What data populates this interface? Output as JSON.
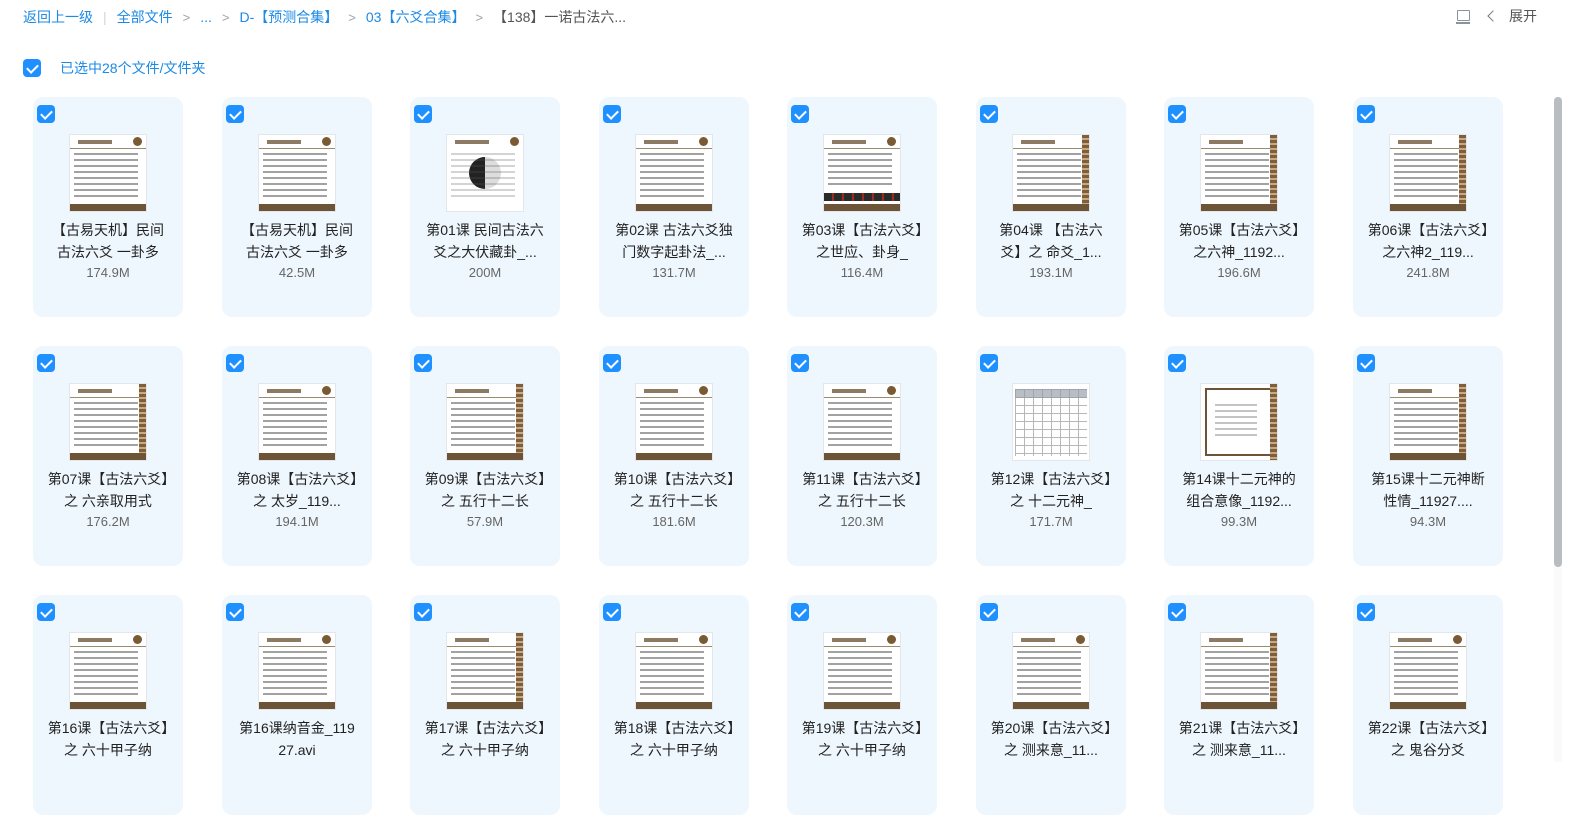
{
  "breadcrumb": {
    "back": "返回上一级",
    "all_files": "全部文件",
    "ellipsis": "...",
    "folder1": "D-【预测合集】",
    "folder2": "03【六爻合集】",
    "current": "【138】一诺古法六..."
  },
  "toolbar": {
    "expand_label": "展开"
  },
  "selection": {
    "label": "已选中28个文件/文件夹"
  },
  "files": [
    {
      "name": "【古易天机】民间古法六爻 一卦多",
      "size": "174.9M",
      "thumb": "lines"
    },
    {
      "name": "【古易天机】民间古法六爻 一卦多",
      "size": "42.5M",
      "thumb": "lines"
    },
    {
      "name": "第01课 民间古法六爻之大伏藏卦_...",
      "size": "200M",
      "thumb": "taiji"
    },
    {
      "name": "第02课 古法六爻独门数字起卦法_...",
      "size": "131.7M",
      "thumb": "lines"
    },
    {
      "name": "第03课【古法六爻】之世应、卦身_",
      "size": "116.4M",
      "thumb": "bars"
    },
    {
      "name": "第04课 【古法六爻】之 命爻_1...",
      "size": "193.1M",
      "thumb": "side"
    },
    {
      "name": "第05课【古法六爻】之六神_1192...",
      "size": "196.6M",
      "thumb": "side"
    },
    {
      "name": "第06课【古法六爻】之六神2_119...",
      "size": "241.8M",
      "thumb": "side"
    },
    {
      "name": "第07课【古法六爻】之 六亲取用式",
      "size": "176.2M",
      "thumb": "side"
    },
    {
      "name": "第08课【古法六爻】之 太岁_119...",
      "size": "194.1M",
      "thumb": "lines"
    },
    {
      "name": "第09课【古法六爻】之 五行十二长",
      "size": "57.9M",
      "thumb": "side"
    },
    {
      "name": "第10课【古法六爻】之 五行十二长",
      "size": "181.6M",
      "thumb": "lines"
    },
    {
      "name": "第11课【古法六爻】之 五行十二长",
      "size": "120.3M",
      "thumb": "lines"
    },
    {
      "name": "第12课【古法六爻】之 十二元神_",
      "size": "171.7M",
      "thumb": "table"
    },
    {
      "name": "第14课十二元神的组合意像_1192...",
      "size": "99.3M",
      "thumb": "frame"
    },
    {
      "name": "第15课十二元神断性情_11927....",
      "size": "94.3M",
      "thumb": "side"
    },
    {
      "name": "第16课【古法六爻】之 六十甲子纳",
      "size": "",
      "thumb": "lines"
    },
    {
      "name": "第16课纳音金_11927.avi",
      "size": "",
      "thumb": "lines"
    },
    {
      "name": "第17课【古法六爻】之 六十甲子纳",
      "size": "",
      "thumb": "side"
    },
    {
      "name": "第18课【古法六爻】之 六十甲子纳",
      "size": "",
      "thumb": "lines"
    },
    {
      "name": "第19课【古法六爻】之 六十甲子纳",
      "size": "",
      "thumb": "lines"
    },
    {
      "name": "第20课【古法六爻】之 测来意_11...",
      "size": "",
      "thumb": "lines"
    },
    {
      "name": "第21课【古法六爻】之 测来意_11...",
      "size": "",
      "thumb": "side"
    },
    {
      "name": "第22课【古法六爻】之 鬼谷分爻",
      "size": "",
      "thumb": "lines"
    }
  ]
}
